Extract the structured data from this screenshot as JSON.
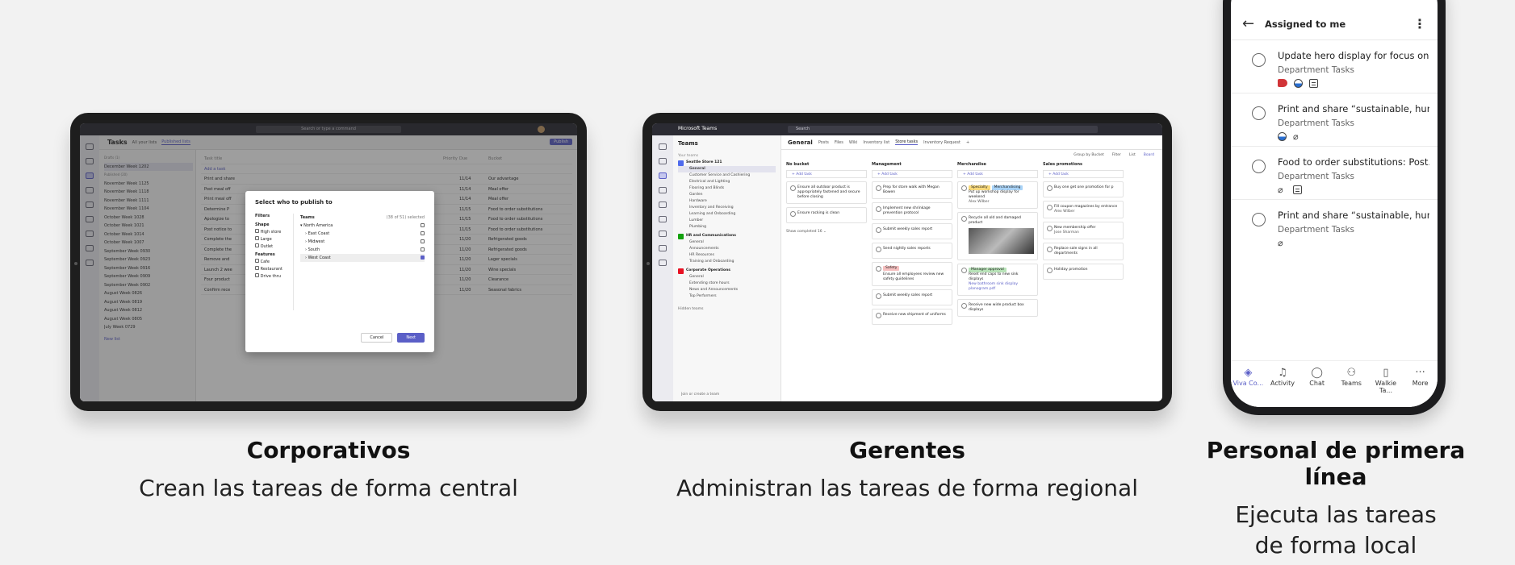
{
  "captions": [
    {
      "title": "Corporativos",
      "subtitle": "Crean las tareas de forma central"
    },
    {
      "title": "Gerentes",
      "subtitle": "Administran las tareas de forma regional"
    },
    {
      "title": "Personal de primera línea",
      "subtitle_line1": "Ejecuta las tareas",
      "subtitle_line2": "de forma local"
    }
  ],
  "tasks_app": {
    "search_placeholder": "Search or type a command",
    "header_title": "Tasks",
    "tab_all": "All your lists",
    "tab_published": "Published lists",
    "publish_button": "Publish",
    "filter_label": "Filter",
    "list_header_drafts": "Drafts (1)",
    "list_header_published": "Published (20)",
    "lists": [
      "December Week 1202",
      "November Week 1125",
      "November Week 1118",
      "November Week 1111",
      "November Week 1104",
      "October Week 1028",
      "October Week 1021",
      "October Week 1014",
      "October Week 1007",
      "September Week 0930",
      "September Week 0923",
      "September Week 0916",
      "September Week 0909",
      "September Week 0902",
      "August Week 0826",
      "August Week 0819",
      "August Week 0812",
      "August Week 0805",
      "July Week 0729"
    ],
    "new_list": "New list",
    "columns": {
      "title": "Task title",
      "priority": "Priority",
      "due": "Due",
      "bucket": "Bucket"
    },
    "rows": [
      {
        "title": "Add a task",
        "due": "",
        "bucket": ""
      },
      {
        "title": "Print and share",
        "due": "11/14",
        "bucket": "Our advantage"
      },
      {
        "title": "Post meal off",
        "due": "11/14",
        "bucket": "Meal offer"
      },
      {
        "title": "Print meal off",
        "due": "11/14",
        "bucket": "Meal offer"
      },
      {
        "title": "Determine P",
        "due": "11/15",
        "bucket": "Food to order substitutions"
      },
      {
        "title": "Apologize to",
        "due": "11/15",
        "bucket": "Food to order substitutions"
      },
      {
        "title": "Post notice to",
        "due": "11/15",
        "bucket": "Food to order substitutions"
      },
      {
        "title": "Complete the",
        "due": "11/20",
        "bucket": "Refrigerated goods"
      },
      {
        "title": "Complete the",
        "due": "11/20",
        "bucket": "Refrigerated goods"
      },
      {
        "title": "Remove and",
        "due": "11/20",
        "bucket": "Lager specials"
      },
      {
        "title": "Launch 2 wee",
        "due": "11/20",
        "bucket": "Wine specials"
      },
      {
        "title": "Four product",
        "due": "11/20",
        "bucket": "Clearance"
      },
      {
        "title": "Confirm rece",
        "due": "11/20",
        "bucket": "Seasonal fabrics"
      }
    ],
    "dialog": {
      "title": "Select who to publish to",
      "filters_label": "Filters",
      "teams_label": "Teams",
      "selected_count": "(38 of 51) selected",
      "shape_label": "Shape",
      "shape_options": [
        "High store",
        "Large",
        "Outlet"
      ],
      "features_label": "Features",
      "feature_options": [
        "Cafe",
        "Restaurant",
        "Drive thru"
      ],
      "teams": [
        "North America",
        "East Coast",
        "Midwest",
        "South",
        "West Coast"
      ],
      "cancel": "Cancel",
      "next": "Next"
    }
  },
  "teams_app": {
    "brand": "Microsoft Teams",
    "search_placeholder": "Search",
    "sidebar_title": "Teams",
    "your_teams": "Your teams",
    "team1": "Seattle Store 121",
    "team1_channels": [
      "General",
      "Customer Service and Cashiering",
      "Electrical and Lighting",
      "Flooring and Blinds",
      "Garden",
      "Hardware",
      "Inventory and Receiving",
      "Learning and Onboarding",
      "Lumber",
      "Plumbing"
    ],
    "team2": "HR and Communications",
    "team2_channels": [
      "General",
      "Announcements",
      "HR Resources",
      "Training and Onboarding"
    ],
    "team3": "Corporate Operations",
    "team3_channels": [
      "General",
      "Extending store hours",
      "News and Announcements",
      "Top Performers"
    ],
    "hidden_teams": "Hidden teams",
    "join_team": "Join or create a team",
    "channel_title": "General",
    "channel_tabs": [
      "Posts",
      "Files",
      "Wiki",
      "Inventory list",
      "Store tasks",
      "Inventory Request"
    ],
    "add_task": "Add task",
    "group_by": "Group by Bucket",
    "filter": "Filter",
    "view_list": "List",
    "view_board": "Board",
    "buckets": [
      {
        "name": "No bucket",
        "cards": [
          "Ensure all outdoor product is appropriately fastened and secure before closing",
          "Ensure racking is clean"
        ],
        "show_completed": "Show completed",
        "completed_count": "16"
      },
      {
        "name": "Management",
        "cards": [
          "Prep for store walk with Megan Bowen",
          "Implement new shrinkage prevention protocol",
          "Submit weekly sales report",
          "Send nightly sales reports",
          "Ensure all employees review new safety guidelines",
          "Submit weekly sales report",
          "Receive new shipment of uniforms"
        ],
        "tag_safety": "Safety"
      },
      {
        "name": "Merchandise",
        "cards": [
          "Put up workshop display for weekend",
          "Recycle all old and damaged product",
          "Reset end caps to new sink displays",
          "Receive new wide product box displays"
        ],
        "tag_specialty": "Specialty",
        "tag_merch": "Merchandising",
        "assignee": "Alex Wilber",
        "tag_manager": "Manager approval",
        "attachment": "New bathroom sink display planogram.pdf"
      },
      {
        "name": "Sales promotions",
        "cards": [
          "Buy one get one promotion for p",
          "Fill coupon magazines by entrance",
          "New membership offer",
          "Replace sale signs in all departments",
          "Holiday promotion"
        ],
        "assignee1": "Alex Wilber",
        "assignee2": "Jose Sharman"
      }
    ]
  },
  "phone_app": {
    "title": "Assigned to me",
    "tasks": [
      {
        "title": "Update hero display for focus on...",
        "bucket": "Department Tasks"
      },
      {
        "title": "Print and share “sustainable, hum...",
        "bucket": "Department Tasks"
      },
      {
        "title": "Food to order substitutions: Post...",
        "bucket": "Department Tasks"
      },
      {
        "title": "Print and share “sustainable, hum...",
        "bucket": "Department Tasks"
      }
    ],
    "nav": [
      "Viva Co...",
      "Activity",
      "Chat",
      "Teams",
      "Walkie Ta...",
      "More"
    ]
  }
}
